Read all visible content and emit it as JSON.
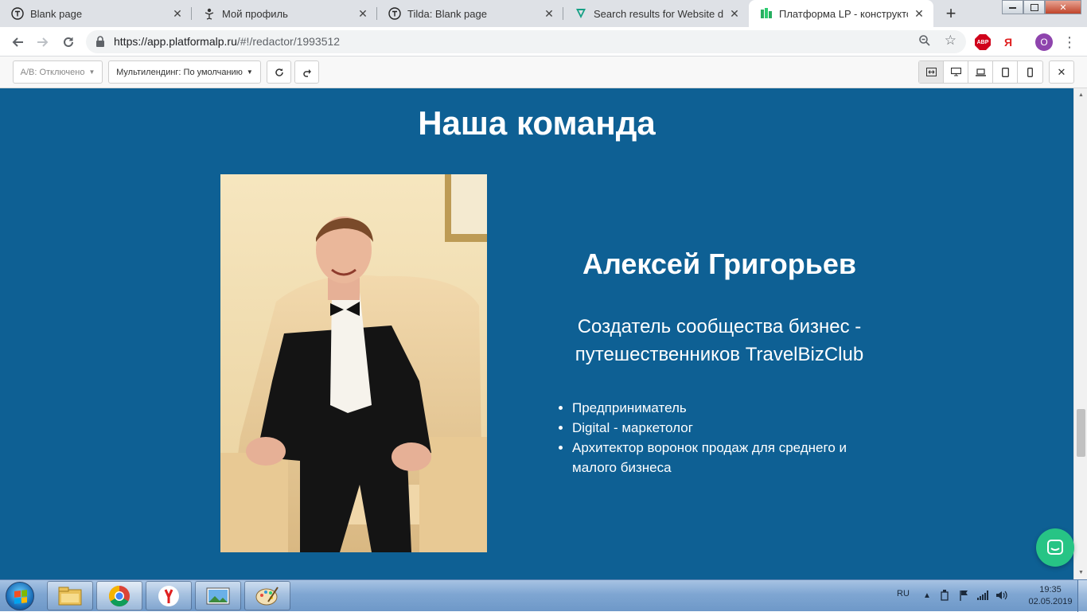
{
  "browser": {
    "tabs": [
      {
        "title": "Blank page",
        "icon": "tilda-icon",
        "active": false
      },
      {
        "title": "Мой профиль",
        "icon": "figure-icon",
        "active": false
      },
      {
        "title": "Tilda: Blank page",
        "icon": "tilda-icon",
        "active": false
      },
      {
        "title": "Search results for Website desig",
        "icon": "v-logo-icon",
        "active": false
      },
      {
        "title": "Платформа LP - конструктор д",
        "icon": "platformalp-icon",
        "active": true
      }
    ],
    "url_host": "https://app.platformalp.ru",
    "url_path": "/#!/redactor/1993512",
    "profile_initial": "O",
    "extension_abp": "ABP",
    "extension_ya": "Я"
  },
  "editor": {
    "ab_label": "А/В: Отключено",
    "multilanding_label": "Мультилендинг: По умолчанию"
  },
  "page": {
    "section_title": "Наша команда",
    "member": {
      "name": "Алексей Григорьев",
      "role": "Создатель сообщества бизнес - путешественников TravelBizClub",
      "facts": [
        "Предприниматель",
        "Digital - маркетолог",
        "Архитектор воронок продаж для среднего и малого бизнеса"
      ]
    },
    "bg_color": "#0e6094",
    "chat_color": "#27c485"
  },
  "taskbar": {
    "lang": "RU",
    "time": "19:35",
    "date": "02.05.2019"
  }
}
